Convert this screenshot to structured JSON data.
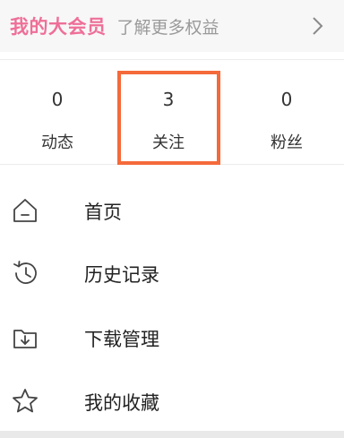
{
  "vip": {
    "title": "我的大会员",
    "subtitle": "了解更多权益",
    "chevron_icon": "chevron-right-icon",
    "title_color": "#ee6f98"
  },
  "stats": [
    {
      "count": "0",
      "label": "动态"
    },
    {
      "count": "3",
      "label": "关注"
    },
    {
      "count": "0",
      "label": "粉丝"
    }
  ],
  "highlight_color": "#f46a3a",
  "menu": {
    "items": [
      {
        "label": "首页",
        "icon": "home-icon"
      },
      {
        "label": "历史记录",
        "icon": "history-icon"
      },
      {
        "label": "下载管理",
        "icon": "download-folder-icon"
      },
      {
        "label": "我的收藏",
        "icon": "star-icon"
      }
    ]
  }
}
